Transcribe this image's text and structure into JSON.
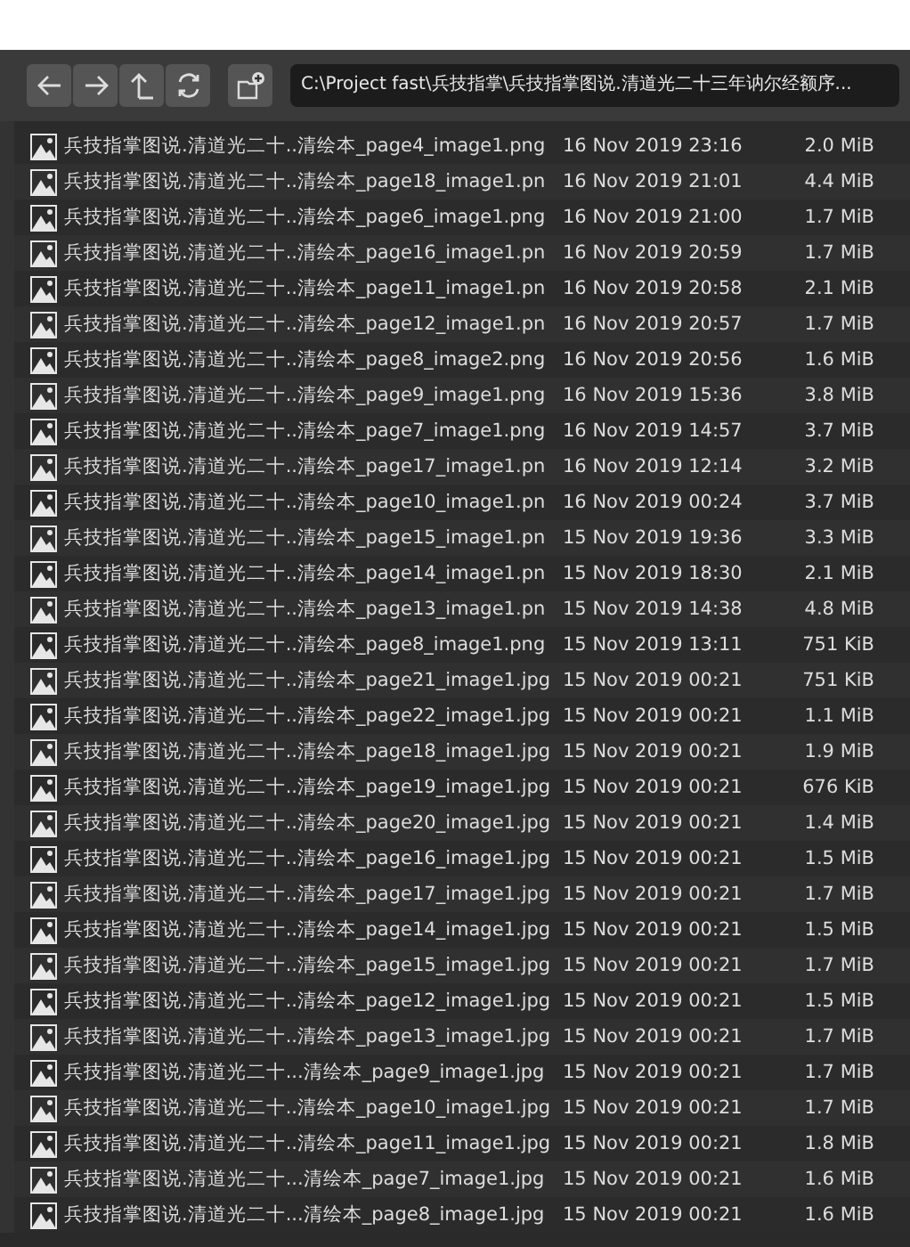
{
  "toolbar": {
    "buttons": [
      {
        "kind": "back"
      },
      {
        "kind": "forward"
      },
      {
        "kind": "parent"
      },
      {
        "kind": "refresh"
      },
      {
        "kind": "new-folder"
      }
    ],
    "path": "C:\\Project fast\\兵技指掌\\兵技指掌图说.清道光二十三年讷尔经额序..."
  },
  "files": [
    {
      "name": "兵技指掌图说.清道光二十..清绘本_page4_image1.png",
      "date": "16 Nov 2019 23:16",
      "size": "2.0 MiB"
    },
    {
      "name": "兵技指掌图说.清道光二十..清绘本_page18_image1.pn",
      "date": "16 Nov 2019 21:01",
      "size": "4.4 MiB"
    },
    {
      "name": "兵技指掌图说.清道光二十..清绘本_page6_image1.png",
      "date": "16 Nov 2019 21:00",
      "size": "1.7 MiB"
    },
    {
      "name": "兵技指掌图说.清道光二十..清绘本_page16_image1.pn",
      "date": "16 Nov 2019 20:59",
      "size": "1.7 MiB"
    },
    {
      "name": "兵技指掌图说.清道光二十..清绘本_page11_image1.pn",
      "date": "16 Nov 2019 20:58",
      "size": "2.1 MiB"
    },
    {
      "name": "兵技指掌图说.清道光二十..清绘本_page12_image1.pn",
      "date": "16 Nov 2019 20:57",
      "size": "1.7 MiB"
    },
    {
      "name": "兵技指掌图说.清道光二十..清绘本_page8_image2.png",
      "date": "16 Nov 2019 20:56",
      "size": "1.6 MiB"
    },
    {
      "name": "兵技指掌图说.清道光二十..清绘本_page9_image1.png",
      "date": "16 Nov 2019 15:36",
      "size": "3.8 MiB"
    },
    {
      "name": "兵技指掌图说.清道光二十..清绘本_page7_image1.png",
      "date": "16 Nov 2019 14:57",
      "size": "3.7 MiB"
    },
    {
      "name": "兵技指掌图说.清道光二十..清绘本_page17_image1.pn",
      "date": "16 Nov 2019 12:14",
      "size": "3.2 MiB"
    },
    {
      "name": "兵技指掌图说.清道光二十..清绘本_page10_image1.pn",
      "date": "16 Nov 2019 00:24",
      "size": "3.7 MiB"
    },
    {
      "name": "兵技指掌图说.清道光二十..清绘本_page15_image1.pn",
      "date": "15 Nov 2019 19:36",
      "size": "3.3 MiB"
    },
    {
      "name": "兵技指掌图说.清道光二十..清绘本_page14_image1.pn",
      "date": "15 Nov 2019 18:30",
      "size": "2.1 MiB"
    },
    {
      "name": "兵技指掌图说.清道光二十..清绘本_page13_image1.pn",
      "date": "15 Nov 2019 14:38",
      "size": "4.8 MiB"
    },
    {
      "name": "兵技指掌图说.清道光二十..清绘本_page8_image1.png",
      "date": "15 Nov 2019 13:11",
      "size": "751 KiB"
    },
    {
      "name": "兵技指掌图说.清道光二十..清绘本_page21_image1.jpg",
      "date": "15 Nov 2019 00:21",
      "size": "751 KiB"
    },
    {
      "name": "兵技指掌图说.清道光二十..清绘本_page22_image1.jpg",
      "date": "15 Nov 2019 00:21",
      "size": "1.1 MiB"
    },
    {
      "name": "兵技指掌图说.清道光二十..清绘本_page18_image1.jpg",
      "date": "15 Nov 2019 00:21",
      "size": "1.9 MiB"
    },
    {
      "name": "兵技指掌图说.清道光二十..清绘本_page19_image1.jpg",
      "date": "15 Nov 2019 00:21",
      "size": "676 KiB"
    },
    {
      "name": "兵技指掌图说.清道光二十..清绘本_page20_image1.jpg",
      "date": "15 Nov 2019 00:21",
      "size": "1.4 MiB"
    },
    {
      "name": "兵技指掌图说.清道光二十..清绘本_page16_image1.jpg",
      "date": "15 Nov 2019 00:21",
      "size": "1.5 MiB"
    },
    {
      "name": "兵技指掌图说.清道光二十..清绘本_page17_image1.jpg",
      "date": "15 Nov 2019 00:21",
      "size": "1.7 MiB"
    },
    {
      "name": "兵技指掌图说.清道光二十..清绘本_page14_image1.jpg",
      "date": "15 Nov 2019 00:21",
      "size": "1.5 MiB"
    },
    {
      "name": "兵技指掌图说.清道光二十..清绘本_page15_image1.jpg",
      "date": "15 Nov 2019 00:21",
      "size": "1.7 MiB"
    },
    {
      "name": "兵技指掌图说.清道光二十..清绘本_page12_image1.jpg",
      "date": "15 Nov 2019 00:21",
      "size": "1.5 MiB"
    },
    {
      "name": "兵技指掌图说.清道光二十..清绘本_page13_image1.jpg",
      "date": "15 Nov 2019 00:21",
      "size": "1.7 MiB"
    },
    {
      "name": "兵技指掌图说.清道光二十...清绘本_page9_image1.jpg",
      "date": "15 Nov 2019 00:21",
      "size": "1.7 MiB"
    },
    {
      "name": "兵技指掌图说.清道光二十..清绘本_page10_image1.jpg",
      "date": "15 Nov 2019 00:21",
      "size": "1.7 MiB"
    },
    {
      "name": "兵技指掌图说.清道光二十..清绘本_page11_image1.jpg",
      "date": "15 Nov 2019 00:21",
      "size": "1.8 MiB"
    },
    {
      "name": "兵技指掌图说.清道光二十...清绘本_page7_image1.jpg",
      "date": "15 Nov 2019 00:21",
      "size": "1.6 MiB"
    },
    {
      "name": "兵技指掌图说.清道光二十...清绘本_page8_image1.jpg",
      "date": "15 Nov 2019 00:21",
      "size": "1.6 MiB"
    }
  ]
}
